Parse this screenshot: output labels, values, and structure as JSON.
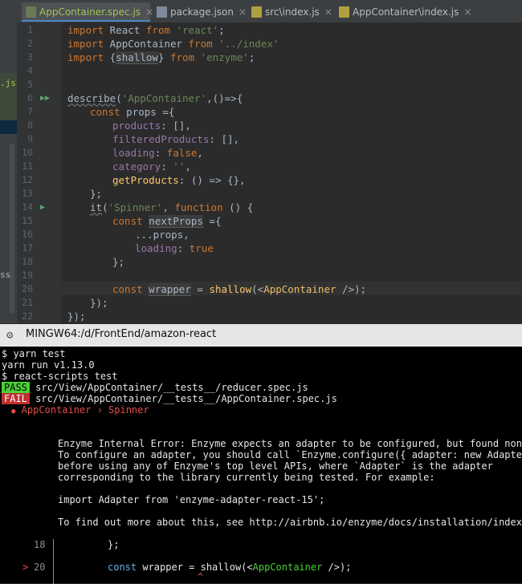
{
  "tabs": [
    {
      "label": "AppContainer.spec.js",
      "active": true
    },
    {
      "label": "package.json",
      "active": false
    },
    {
      "label": "src\\index.js",
      "active": false
    },
    {
      "label": "AppContainer\\index.js",
      "active": false
    }
  ],
  "sidebar": {
    "item_js": ".js",
    "item_ss": "ss"
  },
  "editor": {
    "line_numbers": [
      "1",
      "2",
      "3",
      "4",
      "5",
      "6",
      "7",
      "8",
      "9",
      "10",
      "11",
      "12",
      "13",
      "14",
      "15",
      "16",
      "17",
      "18",
      "19",
      "20",
      "21",
      "22"
    ],
    "code": {
      "l1": {
        "k": "import",
        "a": " React ",
        "k2": "from",
        "s": "'react'",
        "e": ";"
      },
      "l2": {
        "k": "import",
        "a": " AppContainer ",
        "k2": "from",
        "s": "'../index'"
      },
      "l3": {
        "k": "import",
        "a": " {",
        "u": "shallow",
        "b": "} ",
        "k2": "from",
        "s": "'enzyme'",
        "e": ";"
      },
      "l6": {
        "f": "describe",
        "a": "(",
        "s": "'AppContainer'",
        "b": ",()=>{"
      },
      "l7": {
        "k": "const",
        "a": " props ={"
      },
      "l8": {
        "p": "products",
        "a": ": [],"
      },
      "l9": {
        "p": "filteredProducts",
        "a": ": [],"
      },
      "l10": {
        "p": "loading",
        "a": ": ",
        "k": "false",
        "b": ","
      },
      "l11": {
        "p": "category",
        "a": ": ",
        "s": "''",
        "b": ","
      },
      "l12": {
        "f": "getProducts",
        "a": ": () => {},"
      },
      "l13": {
        "a": "};"
      },
      "l14": {
        "f": "it",
        "a": "(",
        "s": "'Spinner'",
        "b": ", ",
        "k": "function",
        "c": " () {"
      },
      "l15": {
        "k": "const",
        "a": " ",
        "u": "nextProps",
        "b": " ={"
      },
      "l16": {
        "a": "...props,"
      },
      "l17": {
        "p": "loading",
        "a": ": ",
        "k": "true"
      },
      "l18": {
        "a": "};"
      },
      "l20": {
        "k": "const",
        "a": " ",
        "u": "wrapper",
        "b": " = ",
        "f": "shallow",
        "c": "(<",
        "t": "AppContainer",
        "d": " />);"
      },
      "l21": {
        "a": "});"
      },
      "l22": {
        "a": "});"
      }
    }
  },
  "terminal": {
    "title": "MINGW64:/d/FrontEnd/amazon-react",
    "l1": "$ yarn test",
    "l2": "yarn run v1.13.0",
    "l3": "$ react-scripts test",
    "pass_badge": "PASS",
    "pass_path": " src/View/AppContainer/__tests__/reducer.spec.js",
    "fail_badge": "FAIL",
    "fail_path": " src/View/AppContainer/__tests__/AppContainer.spec.js",
    "bullet": "●",
    "suite": " AppContainer › Spinner",
    "err1": "Enzyme Internal Error: Enzyme expects an adapter to be configured, but found none.",
    "err2": "To configure an adapter, you should call `Enzyme.configure({ adapter: new Adapter()",
    "err3": "before using any of Enzyme's top level APIs, where `Adapter` is the adapter",
    "err4": "corresponding to the library currently being tested. For example:",
    "err5": "import Adapter from 'enzyme-adapter-react-15';",
    "err6": "To find out more about this, see http://airbnb.io/enzyme/docs/installation/index.ht",
    "s18_num": "18",
    "s18_code": "};",
    "s20_marker": ">",
    "s20_num": "20",
    "s20_kw": "const",
    "s20_a": " wrapper = shallow(<",
    "s20_tag": "AppContainer",
    "s20_b": " />);",
    "caret": "^"
  },
  "colors": {
    "pass": "#4ad135",
    "fail": "#c12f2f",
    "keyword": "#cc7832",
    "string": "#6a8759",
    "property": "#9876aa",
    "function": "#ffc66d"
  }
}
